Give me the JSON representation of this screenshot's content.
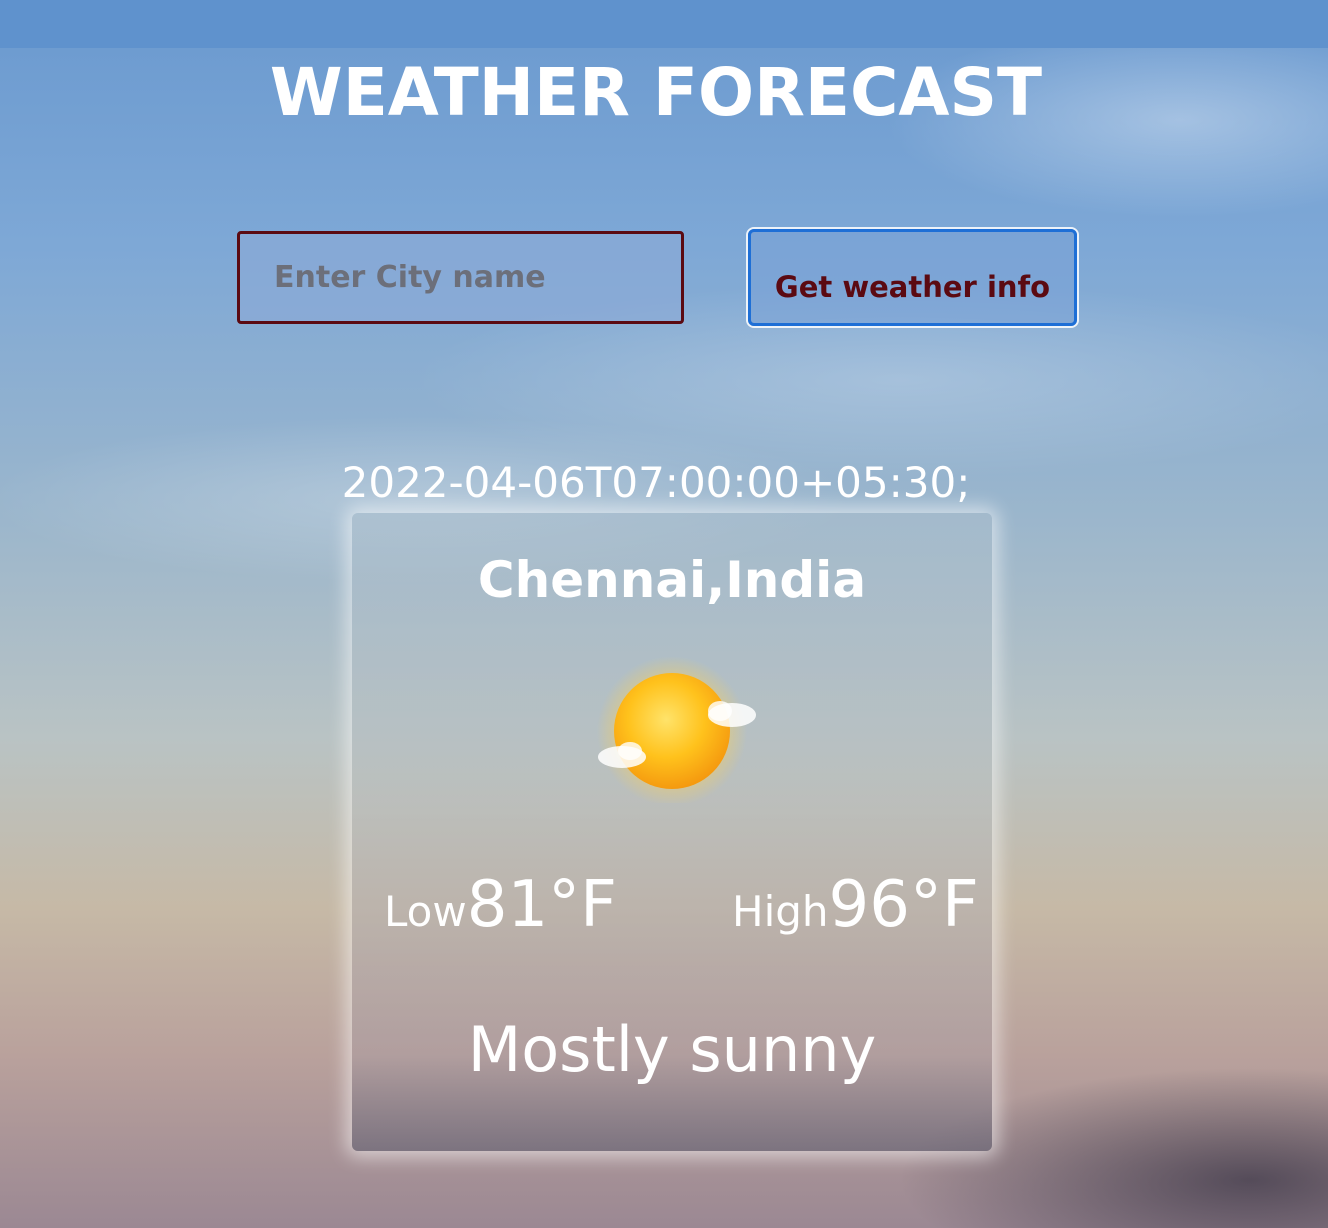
{
  "header": {
    "title": "WEATHER FORECAST"
  },
  "search": {
    "placeholder": "Enter City name",
    "value": "",
    "button_label": "Get weather info"
  },
  "forecast": {
    "timestamp": "2022-04-06T07:00:00+05:30;",
    "location": "Chennai,India",
    "icon": "sun-with-clouds-icon",
    "low_label": "Low",
    "low_value": "81°F",
    "high_label": "High",
    "high_value": "96°F",
    "condition": "Mostly sunny"
  },
  "colors": {
    "input_border": "#5b0a12",
    "button_border": "#1e6fd6",
    "button_text": "#5b0a12",
    "text": "#ffffff"
  }
}
